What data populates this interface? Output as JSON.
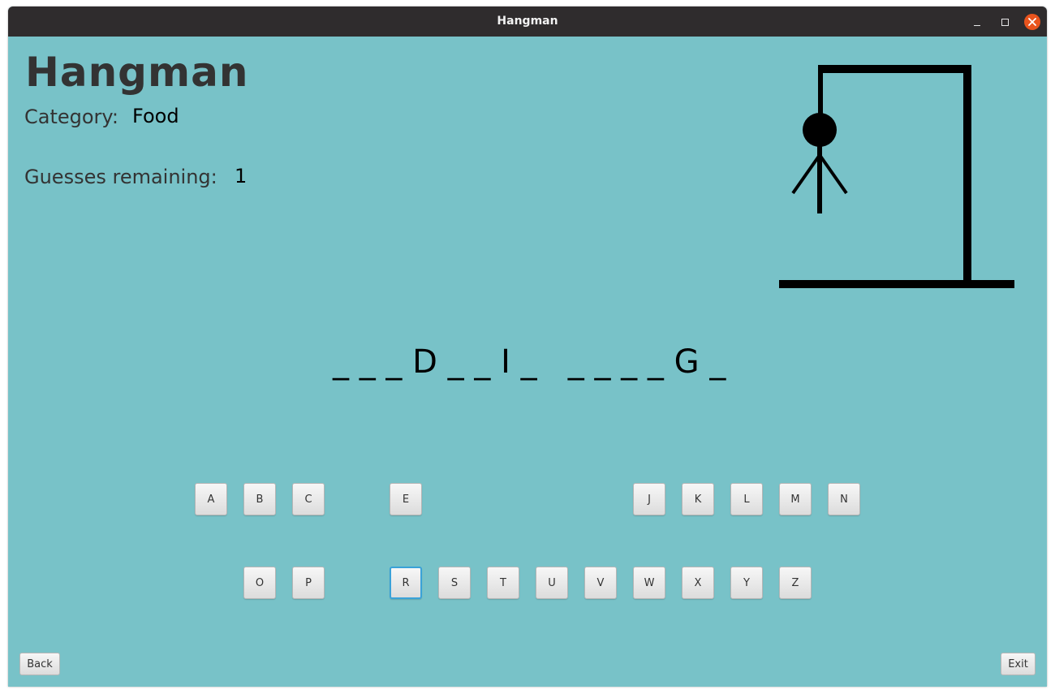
{
  "window": {
    "title": "Hangman",
    "close_color": "#e9541d",
    "background_color": "#78c2c8"
  },
  "header": {
    "title": "Hangman",
    "category_label": "Category:",
    "category_value": "Food",
    "guesses_label": "Guesses remaining:",
    "guesses_value": "1"
  },
  "puzzle": {
    "display": "_ _ _ D _ _ I _   _ _ _ _ G _"
  },
  "hangman": {
    "parts_drawn": [
      "head",
      "body",
      "left-arm",
      "right-arm"
    ]
  },
  "keyboard": {
    "row1": [
      "A",
      "B",
      "C",
      "E",
      "J",
      "K",
      "L",
      "M",
      "N"
    ],
    "row2": [
      "O",
      "P",
      "R",
      "S",
      "T",
      "U",
      "V",
      "W",
      "X",
      "Y",
      "Z"
    ],
    "focused_key": "R"
  },
  "footer": {
    "back_label": "Back",
    "exit_label": "Exit"
  }
}
